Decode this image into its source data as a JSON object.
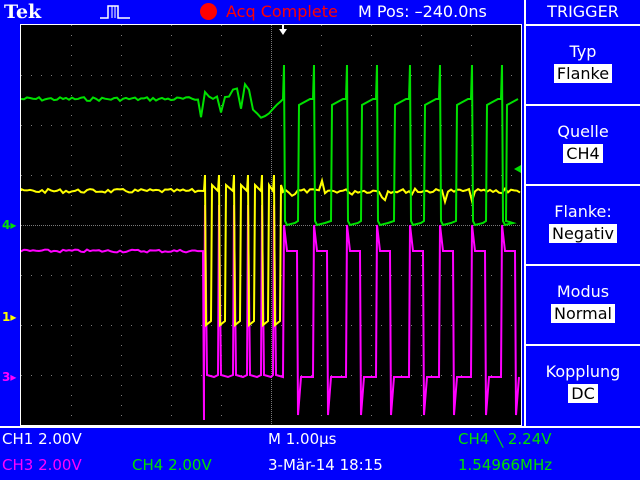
{
  "header": {
    "brand": "Tek",
    "acq_status": "Acq Complete",
    "mpos": "M Pos: –240.0ns"
  },
  "menu": {
    "title": "TRIGGER",
    "items": [
      {
        "label": "Typ",
        "value": "Flanke"
      },
      {
        "label": "Quelle",
        "value": "CH4"
      },
      {
        "label": "Flanke:",
        "value": "Negativ"
      },
      {
        "label": "Modus",
        "value": "Normal"
      },
      {
        "label": "Kopplung",
        "value": "DC"
      }
    ]
  },
  "markers": {
    "ch4": "4",
    "ch1": "1",
    "ch3": "3"
  },
  "status": {
    "ch1": "CH1  2.00V",
    "ch3": "CH3  2.00V",
    "ch4": "CH4  2.00V",
    "timebase": "M 1.00µs",
    "datetime": "3-Mär-14 18:15",
    "trigger": "CH4 ╲ 2.24V",
    "frequency": "1.54966MHz"
  },
  "colors": {
    "ch1": "#ffff00",
    "ch3": "#ff00ff",
    "ch4": "#00e000",
    "acq": "#ff0000",
    "background": "#0000fc"
  }
}
